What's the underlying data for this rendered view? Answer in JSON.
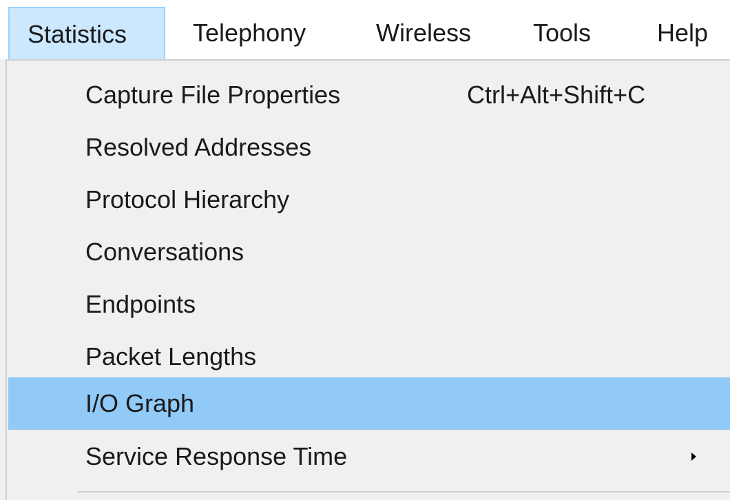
{
  "menubar": {
    "items": [
      {
        "label": "Statistics",
        "active": true
      },
      {
        "label": "Telephony",
        "active": false
      },
      {
        "label": "Wireless",
        "active": false
      },
      {
        "label": "Tools",
        "active": false
      },
      {
        "label": "Help",
        "active": false
      }
    ]
  },
  "statistics_menu": {
    "items": [
      {
        "label": "Capture File Properties",
        "shortcut": "Ctrl+Alt+Shift+C"
      },
      {
        "label": "Resolved Addresses"
      },
      {
        "label": "Protocol Hierarchy"
      },
      {
        "label": "Conversations"
      },
      {
        "label": "Endpoints"
      },
      {
        "label": "Packet Lengths"
      },
      {
        "label": "I/O Graph",
        "highlighted": true
      },
      {
        "label": "Service Response Time",
        "has_submenu": true,
        "submenu_icon": "chevron-right-icon"
      }
    ]
  },
  "colors": {
    "menubar_background": "#ffffff",
    "active_menu_background": "#cce8ff",
    "active_menu_border": "#99d1ff",
    "menu_background": "#f0f0f0",
    "highlight_background": "#91c9f7",
    "text": "#1a1a1a"
  }
}
